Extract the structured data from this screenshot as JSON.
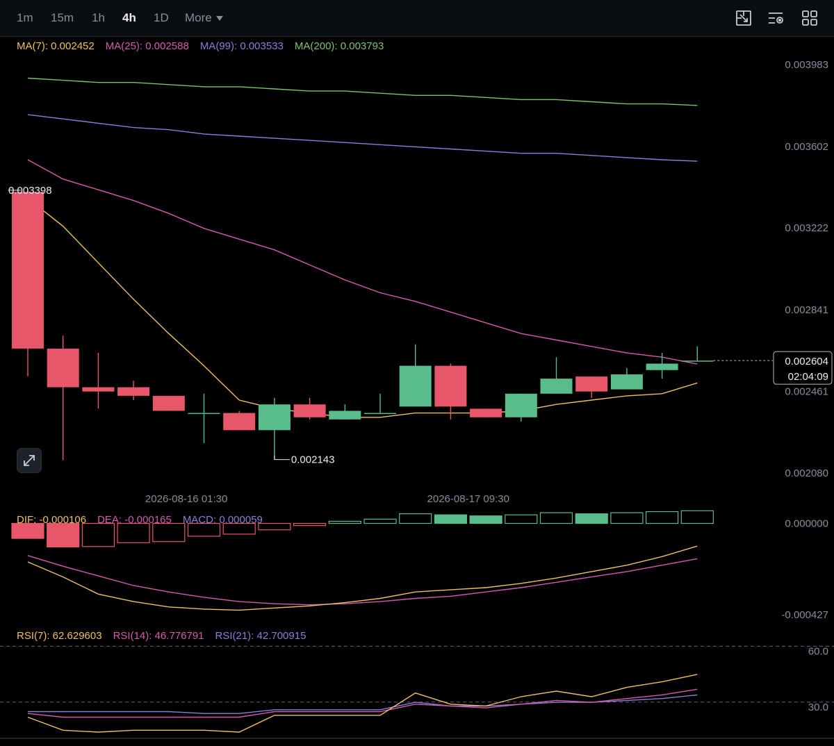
{
  "toolbar": {
    "intervals": [
      "1m",
      "15m",
      "1h",
      "4h",
      "1D"
    ],
    "active_interval": "4h",
    "more_label": "More",
    "icons": [
      "crop-icon",
      "indicator-settings-icon",
      "layout-grid-icon"
    ]
  },
  "colors": {
    "up": "#58bd8b",
    "down": "#e8566a",
    "ma7": "#f0c060",
    "ma25": "#d45bb0",
    "ma99": "#8a7fd8",
    "ma200": "#7cc36a",
    "text": "#848e9c",
    "bg": "#000000",
    "grid_dash": "#5e6673"
  },
  "legend": {
    "main": [
      {
        "text": "MA(7): 0.002452",
        "color": "#f0c060"
      },
      {
        "text": "MA(25): 0.002588",
        "color": "#d45bb0"
      },
      {
        "text": "MA(99): 0.003533",
        "color": "#8a7fd8"
      },
      {
        "text": "MA(200): 0.003793",
        "color": "#7cc36a"
      }
    ],
    "macd": [
      {
        "text": "DIF: -0.000106",
        "color": "#f0c060"
      },
      {
        "text": "DEA: -0.000165",
        "color": "#d45bb0"
      },
      {
        "text": "MACD: 0.000059",
        "color": "#8a7fd8"
      }
    ],
    "rsi": [
      {
        "text": "RSI(7): 62.629603",
        "color": "#f0c060"
      },
      {
        "text": "RSI(14): 46.776791",
        "color": "#d45bb0"
      },
      {
        "text": "RSI(21): 42.700915",
        "color": "#8a7fd8"
      }
    ]
  },
  "chart_data": {
    "type": "candlestick",
    "ylim": [
      0.00198,
      0.00409
    ],
    "price_ticks": [
      "0.003983",
      "0.003602",
      "0.003222",
      "0.002841",
      "0.002461",
      "0.002080"
    ],
    "time_labels": [
      {
        "text": "2026-08-16 01:30",
        "index": 4.5
      },
      {
        "text": "2026-08-17 09:30",
        "index": 12.5
      }
    ],
    "last_price": {
      "value": "0.002604",
      "countdown": "02:04:09"
    },
    "high_label": {
      "text": "0.003398",
      "index": 0
    },
    "low_label": {
      "text": "0.002143",
      "index": 7
    },
    "candles": [
      {
        "o": 0.00339,
        "h": 0.003398,
        "c": 0.00266,
        "l": 0.00253
      },
      {
        "o": 0.00266,
        "h": 0.00272,
        "c": 0.00248,
        "l": 0.00214
      },
      {
        "o": 0.00248,
        "h": 0.00264,
        "c": 0.00246,
        "l": 0.00238
      },
      {
        "o": 0.00248,
        "h": 0.00251,
        "c": 0.00244,
        "l": 0.00242
      },
      {
        "o": 0.00244,
        "h": 0.00244,
        "c": 0.00237,
        "l": 0.00237
      },
      {
        "o": 0.00236,
        "h": 0.00245,
        "c": 0.00236,
        "l": 0.00222
      },
      {
        "o": 0.00236,
        "h": 0.00237,
        "c": 0.00228,
        "l": 0.00228
      },
      {
        "o": 0.00228,
        "h": 0.00243,
        "c": 0.0024,
        "l": 0.002143
      },
      {
        "o": 0.0024,
        "h": 0.00243,
        "c": 0.00234,
        "l": 0.00233
      },
      {
        "o": 0.00233,
        "h": 0.0024,
        "c": 0.00237,
        "l": 0.00233
      },
      {
        "o": 0.00236,
        "h": 0.00245,
        "c": 0.00236,
        "l": 0.00236
      },
      {
        "o": 0.00239,
        "h": 0.00268,
        "c": 0.00258,
        "l": 0.00239
      },
      {
        "o": 0.00258,
        "h": 0.00259,
        "c": 0.00239,
        "l": 0.00233
      },
      {
        "o": 0.00238,
        "h": 0.00238,
        "c": 0.00234,
        "l": 0.00234
      },
      {
        "o": 0.00234,
        "h": 0.00245,
        "c": 0.00245,
        "l": 0.00232
      },
      {
        "o": 0.00245,
        "h": 0.00262,
        "c": 0.00252,
        "l": 0.00245
      },
      {
        "o": 0.00253,
        "h": 0.00253,
        "c": 0.00246,
        "l": 0.00243
      },
      {
        "o": 0.00247,
        "h": 0.00257,
        "c": 0.00254,
        "l": 0.00247
      },
      {
        "o": 0.00256,
        "h": 0.00264,
        "c": 0.00259,
        "l": 0.00252
      },
      {
        "o": 0.0026,
        "h": 0.00267,
        "c": 0.002604,
        "l": 0.002604
      }
    ],
    "ma": {
      "ma7": [
        0.00336,
        0.00323,
        0.00306,
        0.00289,
        0.00273,
        0.00258,
        0.00242,
        0.00238,
        0.00236,
        0.00234,
        0.00234,
        0.00236,
        0.00236,
        0.00236,
        0.00237,
        0.0024,
        0.00242,
        0.00244,
        0.00245,
        0.0025
      ],
      "ma25": [
        0.00354,
        0.00345,
        0.0034,
        0.00335,
        0.00329,
        0.00322,
        0.00317,
        0.00312,
        0.00305,
        0.00298,
        0.00292,
        0.00288,
        0.00283,
        0.00278,
        0.00273,
        0.0027,
        0.00267,
        0.00264,
        0.00262,
        0.002588
      ],
      "ma99": [
        0.00375,
        0.00373,
        0.00371,
        0.00369,
        0.00368,
        0.00366,
        0.00365,
        0.00364,
        0.00363,
        0.00362,
        0.00361,
        0.0036,
        0.00359,
        0.00358,
        0.00357,
        0.00357,
        0.00356,
        0.00355,
        0.00354,
        0.003533
      ],
      "ma200": [
        0.00392,
        0.00391,
        0.0039,
        0.0039,
        0.00389,
        0.00388,
        0.00388,
        0.00387,
        0.00386,
        0.00386,
        0.00385,
        0.00384,
        0.00384,
        0.00383,
        0.00382,
        0.00382,
        0.00381,
        0.0038,
        0.0038,
        0.003793
      ]
    },
    "macd": {
      "ylim": [
        -0.000475,
        5e-06
      ],
      "ticks": [
        "0.000000",
        "-0.000427"
      ],
      "hist": [
        -7e-05,
        -0.00011,
        -0.000108,
        -9e-05,
        -8.5e-05,
        -6e-05,
        -5e-05,
        -3e-05,
        -1e-05,
        1e-05,
        2e-05,
        4.5e-05,
        4e-05,
        3.5e-05,
        4e-05,
        5e-05,
        4.5e-05,
        5e-05,
        5.5e-05,
        5.9e-05
      ],
      "dif": [
        -0.00018,
        -0.00025,
        -0.00033,
        -0.000365,
        -0.00039,
        -0.0004,
        -0.000405,
        -0.000395,
        -0.000385,
        -0.00037,
        -0.00035,
        -0.00032,
        -0.00031,
        -0.0003,
        -0.00028,
        -0.000255,
        -0.000225,
        -0.000195,
        -0.000155,
        -0.000106
      ],
      "dea": [
        -0.00015,
        -0.0002,
        -0.000245,
        -0.00029,
        -0.00032,
        -0.000345,
        -0.000365,
        -0.000375,
        -0.00038,
        -0.000375,
        -0.000365,
        -0.00035,
        -0.00034,
        -0.00032,
        -0.0003,
        -0.000275,
        -0.00025,
        -0.000225,
        -0.000195,
        -0.000165
      ]
    },
    "rsi": {
      "ylim": [
        15,
        65
      ],
      "ticks": [
        "60.0",
        "30.0"
      ],
      "rsi7": [
        26,
        19,
        18,
        19,
        19,
        19,
        18,
        27,
        27,
        27,
        27,
        39,
        33,
        32,
        37,
        40,
        37,
        42,
        45,
        49
      ],
      "rsi14": [
        28,
        26,
        26,
        26,
        26,
        26,
        26,
        29,
        29,
        29,
        29,
        33,
        32,
        31,
        33,
        35,
        34,
        36,
        38,
        41
      ],
      "rsi21": [
        29,
        29,
        29,
        29,
        29,
        28,
        28,
        30,
        30,
        30,
        30,
        34,
        32,
        32,
        33,
        34,
        34,
        35,
        36,
        38
      ]
    }
  }
}
